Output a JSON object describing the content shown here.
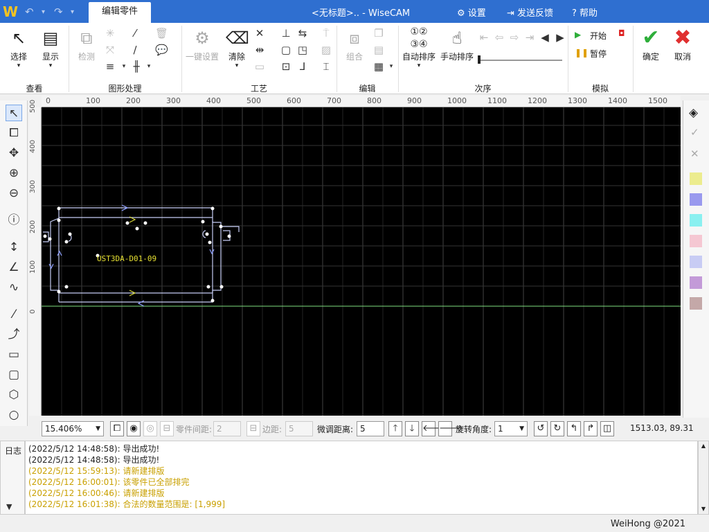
{
  "app": {
    "logo": "W",
    "title": "<无标题>.. - WiseCAM",
    "active_tab": "编辑零件",
    "settings": "设置",
    "feedback": "发送反馈",
    "help": "帮助"
  },
  "ribbon": {
    "groups": [
      "查看",
      "图形处理",
      "工艺",
      "编辑",
      "次序",
      "模拟"
    ],
    "select": "选择",
    "display": "显示",
    "detect": "检测",
    "one_click": "一键设置",
    "clear": "清除",
    "combine": "组合",
    "auto_order": "自动排序",
    "manual_order": "手动排序",
    "start": "开始",
    "pause": "暂停",
    "ok": "确定",
    "cancel": "取消"
  },
  "ruler": {
    "x_ticks": [
      "0",
      "100",
      "200",
      "300",
      "400",
      "500",
      "600",
      "700",
      "800",
      "900",
      "1000",
      "1100",
      "1200",
      "1300",
      "1400",
      "1500"
    ],
    "y_ticks": [
      "0",
      "100",
      "200",
      "300",
      "400",
      "500"
    ]
  },
  "canvas": {
    "part_label": "UST3DA-D01-09"
  },
  "swatches": [
    "#ecec8e",
    "#9999ee",
    "#8af0f0",
    "#f5c7d2",
    "#c8ccf4",
    "#c39ad8",
    "#c4a8a8"
  ],
  "status": {
    "zoom": "15.406%",
    "part_gap_label": "零件间距:",
    "part_gap": "2",
    "margin_label": "边距:",
    "margin": "5",
    "nudge_label": "微调距离:",
    "nudge": "5",
    "rotate_label": "旋转角度:",
    "rotate": "1",
    "coords": "1513.03, 89.31"
  },
  "log": {
    "tab": "日志",
    "lines": [
      {
        "text": "(2022/5/12 14:48:58): 导出成功!",
        "color": "#222"
      },
      {
        "text": "(2022/5/12 14:48:58): 导出成功!",
        "color": "#222"
      },
      {
        "text": "(2022/5/12 15:59:13): 请新建排版",
        "color": "#c9a000"
      },
      {
        "text": "(2022/5/12 16:00:01): 该零件已全部排完",
        "color": "#c9a000"
      },
      {
        "text": "(2022/5/12 16:00:46): 请新建排版",
        "color": "#c9a000"
      },
      {
        "text": "(2022/5/12 16:01:38): 合法的数量范围是: [1,999]",
        "color": "#c9a000"
      }
    ]
  },
  "footer": "WeiHong @2021"
}
